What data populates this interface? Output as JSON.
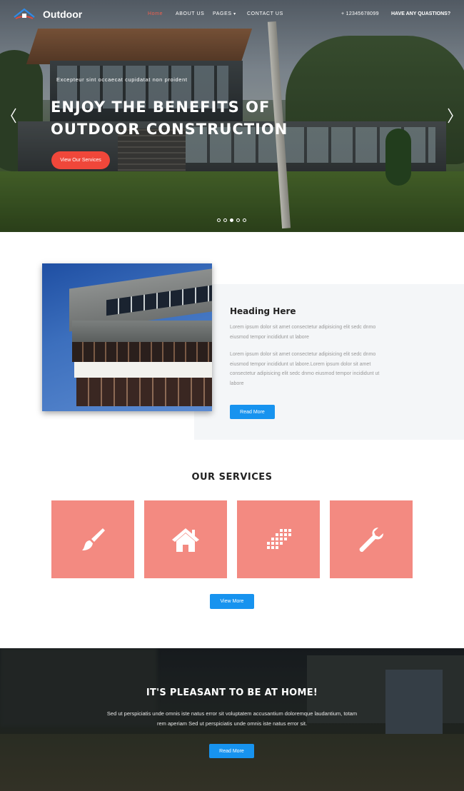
{
  "nav": {
    "logo": "Outdoor",
    "links": [
      "Home",
      "ABOUT US",
      "PAGES",
      "CONTACT US"
    ],
    "phone": "+ 12345678099",
    "question": "HAVE ANY QUASTIONS?"
  },
  "hero": {
    "subtitle": "Excepteur sint occaecat cupidatat non proident",
    "title": "ENJOY THE BENEFITS OF OUTDOOR CONSTRUCTION",
    "button": "View Our Services",
    "slides": 5,
    "active_slide": 3
  },
  "about": {
    "heading": "Heading Here",
    "para1": "Lorem ipsum dolor sit amet consectetur adipisicing elit sedc dnmo eiusmod tempor incididunt ut labore",
    "para2": "Lorem ipsum dolor sit amet consectetur adipisicing elit sedc dnmo eiusmod tempor incididunt ut labore.Lorem ipsum dolor sit amet consectetur adipisicing elit sedc dnmo eiusmod tempor incididunt ut labore",
    "button": "Read More"
  },
  "services": {
    "title": "OUR SERVICES",
    "items": [
      "brush-icon",
      "home-icon",
      "pixels-icon",
      "wrench-icon"
    ],
    "button": "View More"
  },
  "banner": {
    "title": "IT'S PLEASANT TO BE AT HOME!",
    "text": "Sed ut perspiciatis unde omnis iste natus error sit voluptatem accusantium doloremque laudantium, totam rem aperiam Sed ut perspiciatis unde omnis iste natus error sit.",
    "button": "Read More"
  },
  "colors": {
    "accent_red": "#f0473a",
    "accent_blue": "#1793ef",
    "service_tile": "#f38a81"
  }
}
